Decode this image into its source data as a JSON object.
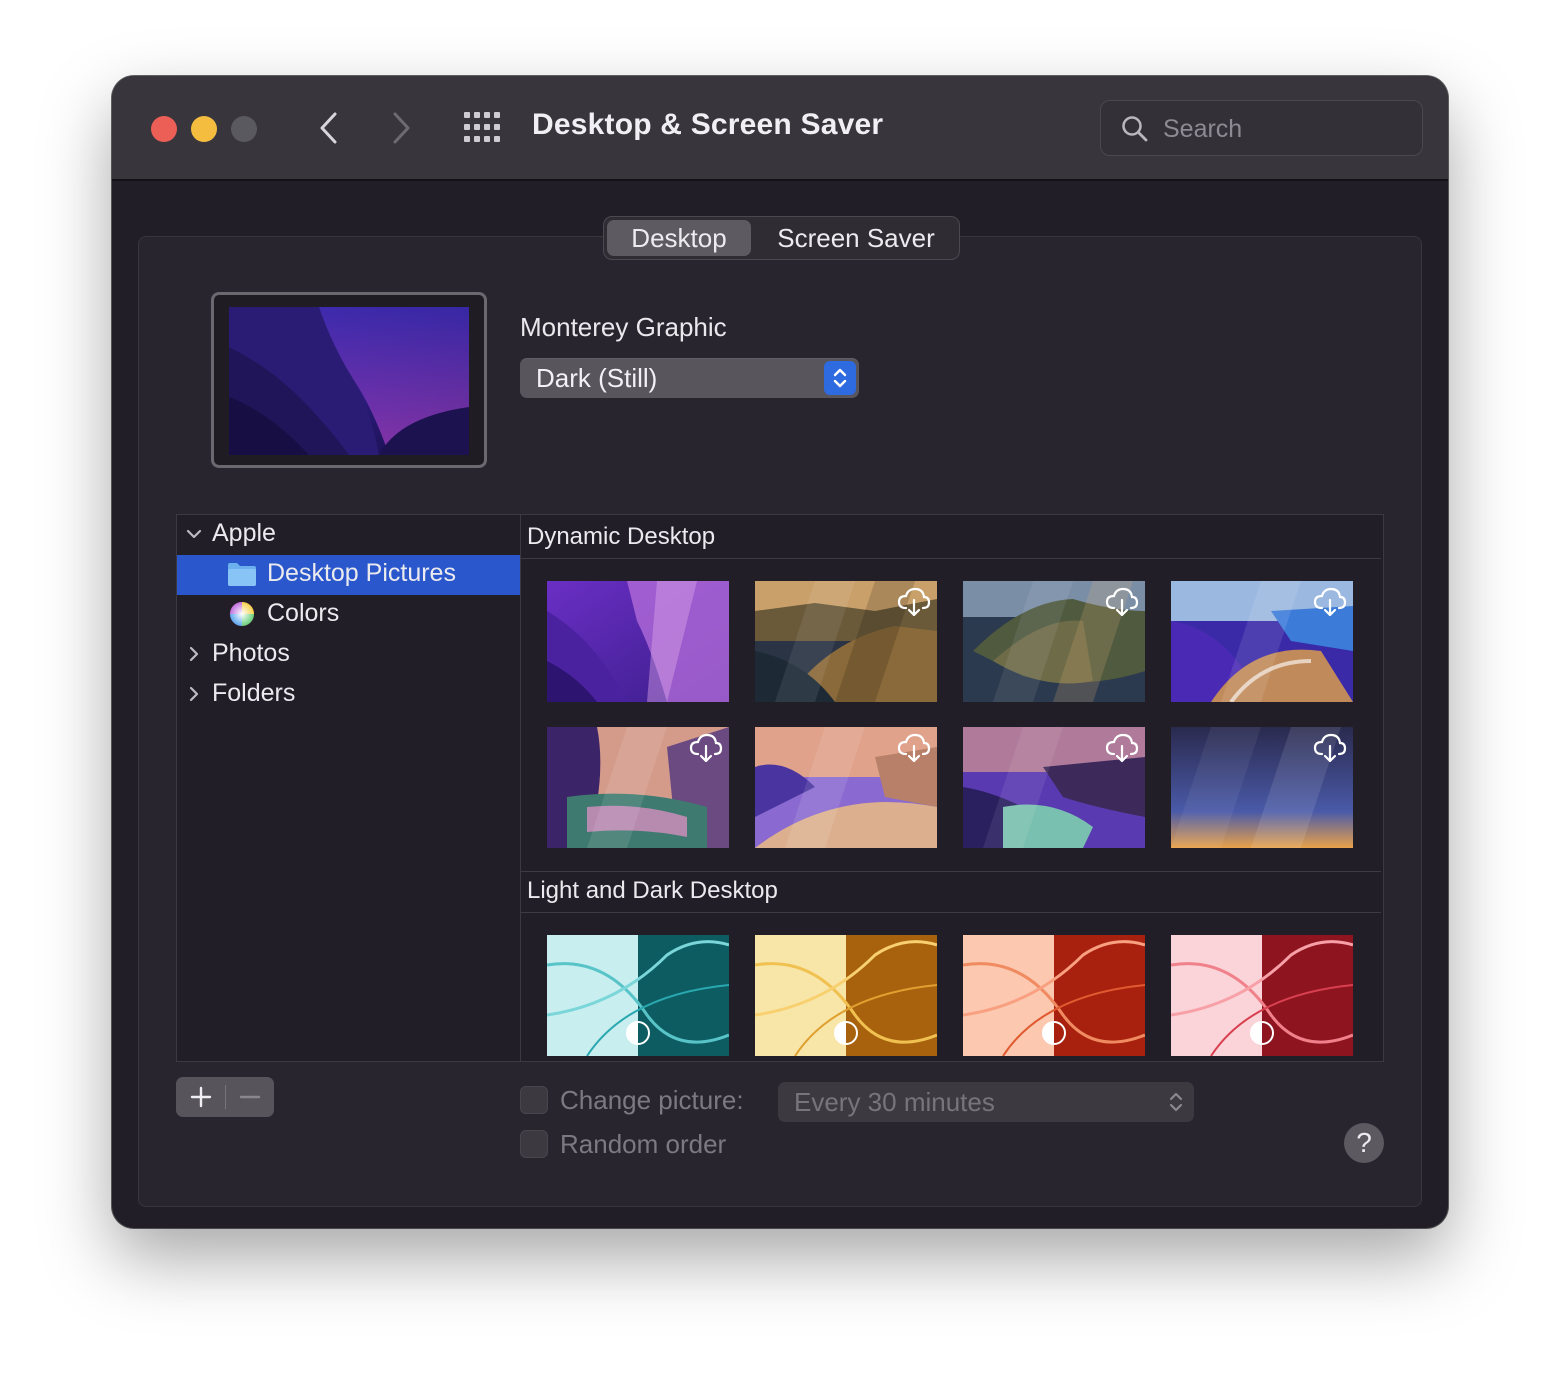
{
  "window": {
    "title": "Desktop & Screen Saver"
  },
  "search": {
    "placeholder": "Search"
  },
  "tabs": [
    {
      "label": "Desktop",
      "active": true
    },
    {
      "label": "Screen Saver",
      "active": false
    }
  ],
  "current": {
    "name": "Monterey Graphic",
    "appearance": "Dark (Still)"
  },
  "sidebar": {
    "items": [
      {
        "label": "Apple",
        "expanded": true
      },
      {
        "label": "Desktop Pictures",
        "selected": true
      },
      {
        "label": "Colors"
      },
      {
        "label": "Photos",
        "expanded": false
      },
      {
        "label": "Folders",
        "expanded": false
      }
    ]
  },
  "sections": [
    {
      "title": "Dynamic Desktop"
    },
    {
      "title": "Light and Dark Desktop"
    }
  ],
  "options": {
    "change_picture_label": "Change picture:",
    "change_picture_checked": false,
    "interval": "Every 30 minutes",
    "random_order_label": "Random order",
    "random_order_checked": false
  },
  "help": {
    "label": "?"
  },
  "colors": {
    "accent": "#2a58cc",
    "popup_accent": "#2e6be0"
  }
}
